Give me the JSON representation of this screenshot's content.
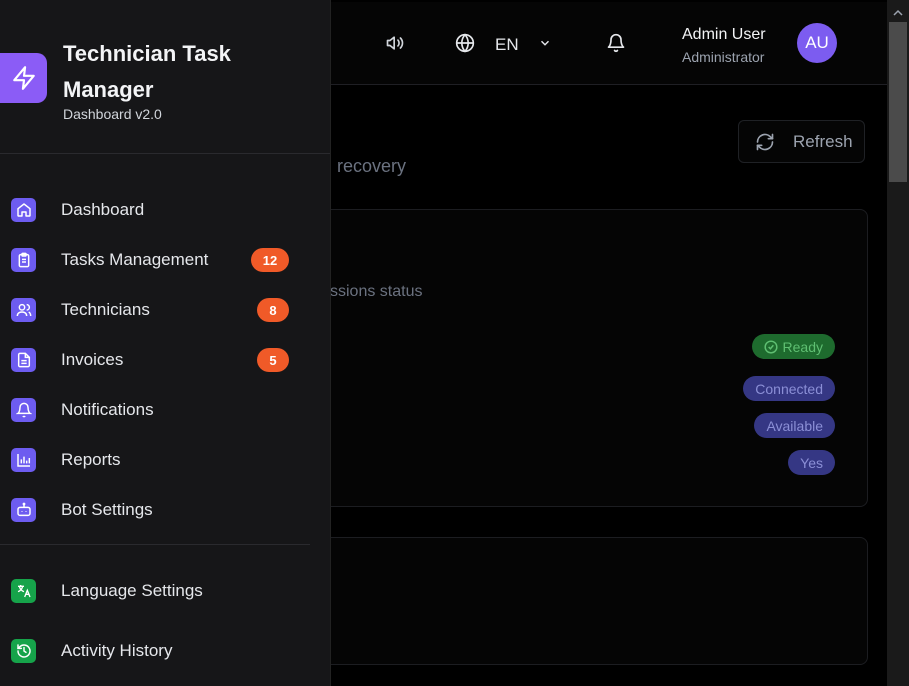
{
  "app": {
    "title": "Technician Task Manager",
    "version": "Dashboard v2.0",
    "logo_icon": "lightning-icon",
    "accent_color": "#8b5cf6"
  },
  "header": {
    "language": "EN",
    "user_name": "Admin User",
    "user_role": "Administrator",
    "avatar_initials": "AU"
  },
  "sidebar": {
    "items": [
      {
        "label": "Dashboard",
        "icon": "home-icon"
      },
      {
        "label": "Tasks Management",
        "icon": "clipboard-icon",
        "badge": "12"
      },
      {
        "label": "Technicians",
        "icon": "users-icon",
        "badge": "8"
      },
      {
        "label": "Invoices",
        "icon": "file-text-icon",
        "badge": "5"
      },
      {
        "label": "Notifications",
        "icon": "bell-icon"
      },
      {
        "label": "Reports",
        "icon": "bar-chart-icon"
      },
      {
        "label": "Bot Settings",
        "icon": "bot-icon"
      }
    ],
    "secondary": [
      {
        "label": "Language Settings",
        "icon": "translate-icon"
      },
      {
        "label": "Activity History",
        "icon": "history-icon"
      }
    ]
  },
  "main": {
    "refresh_label": "Refresh",
    "subtitle_partial": "recovery",
    "card_desc_partial": "ssions status",
    "statuses": [
      "Ready",
      "Connected",
      "Available",
      "Yes"
    ]
  }
}
